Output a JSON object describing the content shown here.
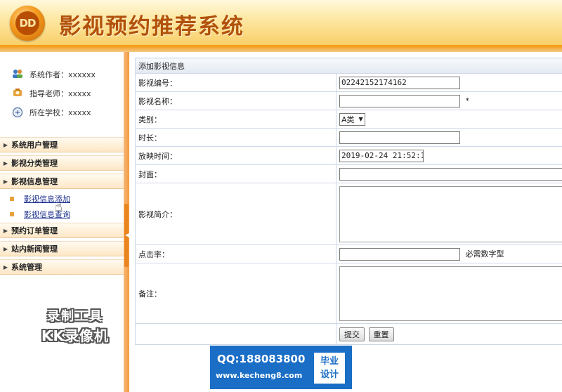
{
  "header": {
    "logo_text": "DD",
    "title": "影视预约推荐系统"
  },
  "sidebar": {
    "info": [
      {
        "icon": "user-group-icon",
        "text": "系统作者：xxxxxx"
      },
      {
        "icon": "teacher-icon",
        "text": "指导老师：xxxxx"
      },
      {
        "icon": "school-icon",
        "text": "所在学校：xxxxx"
      }
    ],
    "menus": [
      {
        "label": "系统用户管理"
      },
      {
        "label": "影视分类管理"
      },
      {
        "label": "影视信息管理"
      },
      {
        "label": "预约订单管理"
      },
      {
        "label": "站内新闻管理"
      },
      {
        "label": "系统管理"
      }
    ],
    "submenu": [
      {
        "label": "影视信息添加"
      },
      {
        "label": "影视信息查询"
      }
    ]
  },
  "watermark": {
    "line1": "录制工具",
    "line2": "KK录像机"
  },
  "form": {
    "caption": "添加影视信息",
    "fields": {
      "code": {
        "label": "影视编号：",
        "value": "02242152174162"
      },
      "name": {
        "label": "影视名称：",
        "value": "",
        "required": "*"
      },
      "category": {
        "label": "类别：",
        "value": "A类"
      },
      "duration": {
        "label": "时长：",
        "value": ""
      },
      "showtime": {
        "label": "放映时间：",
        "value": "2019-02-24 21:52:1"
      },
      "cover": {
        "label": "封面：",
        "value": ""
      },
      "intro": {
        "label": "影视简介：",
        "value": ""
      },
      "clicks": {
        "label": "点击率：",
        "value": "",
        "hint": "必需数字型"
      },
      "remark": {
        "label": "备注：",
        "value": ""
      }
    },
    "buttons": {
      "submit": "提交",
      "reset": "重置"
    }
  },
  "ad": {
    "qq": "QQ:188083800",
    "site": "www.kecheng8.com",
    "badge_line1": "毕业",
    "badge_line2": "设计"
  },
  "colors": {
    "header_orange": "#f59a0c",
    "title_brown": "#b2520a",
    "link_blue": "#1a2e8c",
    "ad_blue": "#1a6ec6"
  }
}
